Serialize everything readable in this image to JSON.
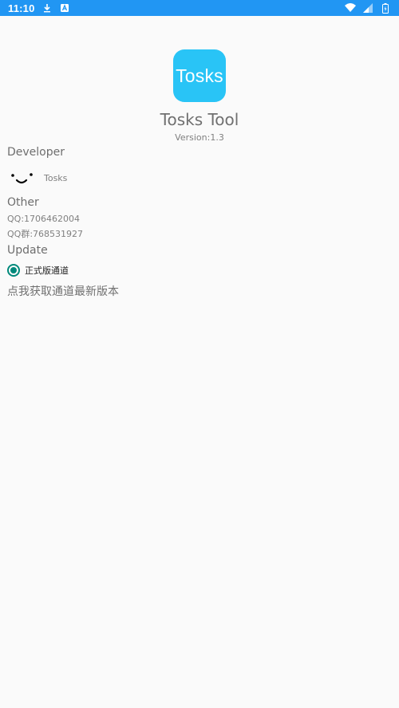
{
  "status_bar": {
    "time": "11:10",
    "icons_left": [
      "download-icon",
      "notification-a-icon"
    ],
    "icons_right": [
      "wifi-icon",
      "signal-icon",
      "battery-icon"
    ]
  },
  "app": {
    "icon_text": "Tosks",
    "name": "Tosks Tool",
    "version": "Version:1.3"
  },
  "developer": {
    "title": "Developer",
    "avatar_icon": "smiley-icon",
    "name": "Tosks"
  },
  "other": {
    "title": "Other",
    "qq": "QQ:1706462004",
    "qq_group": "QQ群:768531927"
  },
  "update": {
    "title": "Update",
    "channel_label": "正式版通道",
    "channel_selected": true,
    "fetch_text": "点我获取通道最新版本"
  },
  "colors": {
    "status_bar": "#2196f3",
    "app_icon": "#29c4f6",
    "radio_accent": "#00897b",
    "background": "#fafafa"
  }
}
